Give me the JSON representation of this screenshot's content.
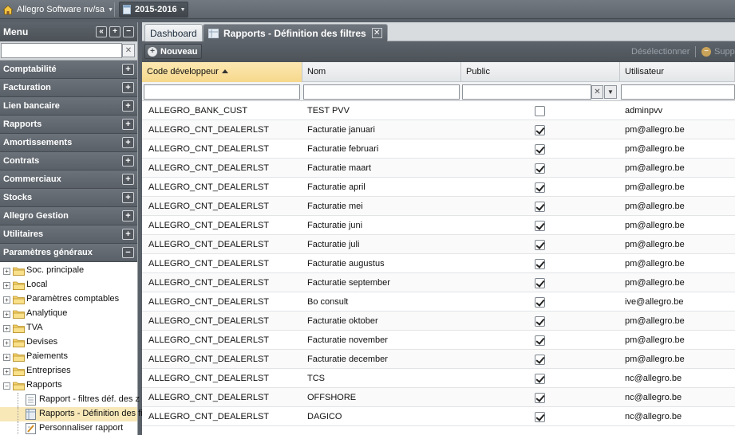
{
  "topbar": {
    "company": "Allegro Software nv/sa",
    "year": "2015-2016"
  },
  "menu": {
    "title": "Menu",
    "search_value": "",
    "categories": [
      {
        "label": "Comptabilité",
        "toggle": "+"
      },
      {
        "label": "Facturation",
        "toggle": "+"
      },
      {
        "label": "Lien bancaire",
        "toggle": "+"
      },
      {
        "label": "Rapports",
        "toggle": "+"
      },
      {
        "label": "Amortissements",
        "toggle": "+"
      },
      {
        "label": "Contrats",
        "toggle": "+"
      },
      {
        "label": "Commerciaux",
        "toggle": "+"
      },
      {
        "label": "Stocks",
        "toggle": "+"
      },
      {
        "label": "Allegro Gestion",
        "toggle": "+"
      },
      {
        "label": "Utilitaires",
        "toggle": "+"
      },
      {
        "label": "Paramètres généraux",
        "toggle": "−"
      }
    ],
    "tree": [
      {
        "label": "Soc. principale",
        "expander": "+"
      },
      {
        "label": "Local",
        "expander": "+"
      },
      {
        "label": "Paramètres comptables",
        "expander": "+"
      },
      {
        "label": "Analytique",
        "expander": "+"
      },
      {
        "label": "TVA",
        "expander": "+"
      },
      {
        "label": "Devises",
        "expander": "+"
      },
      {
        "label": "Paiements",
        "expander": "+"
      },
      {
        "label": "Entreprises",
        "expander": "+"
      },
      {
        "label": "Rapports",
        "expander": "−"
      }
    ],
    "subtree": [
      {
        "label": "Rapport - filtres déf. des z"
      },
      {
        "label": "Rapports - Définition des filtres"
      },
      {
        "label": "Personnaliser rapport"
      }
    ]
  },
  "tabs": [
    {
      "label": "Dashboard"
    },
    {
      "label": "Rapports - Définition des filtres",
      "close": "✕"
    }
  ],
  "toolbar": {
    "new_label": "Nouveau",
    "deselect_label": "Désélectionner",
    "delete_label": "Supprimer"
  },
  "grid": {
    "columns": [
      "Code développeur",
      "Nom",
      "Public",
      "Utilisateur"
    ],
    "rows": [
      {
        "code": "ALLEGRO_BANK_CUST",
        "nom": "TEST PVV",
        "public": false,
        "user": "adminpvv"
      },
      {
        "code": "ALLEGRO_CNT_DEALERLST",
        "nom": "Facturatie januari",
        "public": true,
        "user": "pm@allegro.be"
      },
      {
        "code": "ALLEGRO_CNT_DEALERLST",
        "nom": "Facturatie februari",
        "public": true,
        "user": "pm@allegro.be"
      },
      {
        "code": "ALLEGRO_CNT_DEALERLST",
        "nom": "Facturatie maart",
        "public": true,
        "user": "pm@allegro.be"
      },
      {
        "code": "ALLEGRO_CNT_DEALERLST",
        "nom": "Facturatie april",
        "public": true,
        "user": "pm@allegro.be"
      },
      {
        "code": "ALLEGRO_CNT_DEALERLST",
        "nom": "Facturatie mei",
        "public": true,
        "user": "pm@allegro.be"
      },
      {
        "code": "ALLEGRO_CNT_DEALERLST",
        "nom": "Facturatie juni",
        "public": true,
        "user": "pm@allegro.be"
      },
      {
        "code": "ALLEGRO_CNT_DEALERLST",
        "nom": "Facturatie juli",
        "public": true,
        "user": "pm@allegro.be"
      },
      {
        "code": "ALLEGRO_CNT_DEALERLST",
        "nom": "Facturatie augustus",
        "public": true,
        "user": "pm@allegro.be"
      },
      {
        "code": "ALLEGRO_CNT_DEALERLST",
        "nom": "Facturatie september",
        "public": true,
        "user": "pm@allegro.be"
      },
      {
        "code": "ALLEGRO_CNT_DEALERLST",
        "nom": "Bo consult",
        "public": true,
        "user": "ive@allegro.be"
      },
      {
        "code": "ALLEGRO_CNT_DEALERLST",
        "nom": "Facturatie oktober",
        "public": true,
        "user": "pm@allegro.be"
      },
      {
        "code": "ALLEGRO_CNT_DEALERLST",
        "nom": "Facturatie november",
        "public": true,
        "user": "pm@allegro.be"
      },
      {
        "code": "ALLEGRO_CNT_DEALERLST",
        "nom": "Facturatie december",
        "public": true,
        "user": "pm@allegro.be"
      },
      {
        "code": "ALLEGRO_CNT_DEALERLST",
        "nom": "TCS",
        "public": true,
        "user": "nc@allegro.be"
      },
      {
        "code": "ALLEGRO_CNT_DEALERLST",
        "nom": "OFFSHORE",
        "public": true,
        "user": "nc@allegro.be"
      },
      {
        "code": "ALLEGRO_CNT_DEALERLST",
        "nom": "DAGICO",
        "public": true,
        "user": "nc@allegro.be"
      }
    ]
  },
  "colors": {
    "selected_row": "#f8e8b8",
    "sorted_header": "#f6d88c",
    "panel_header": "#596067"
  }
}
